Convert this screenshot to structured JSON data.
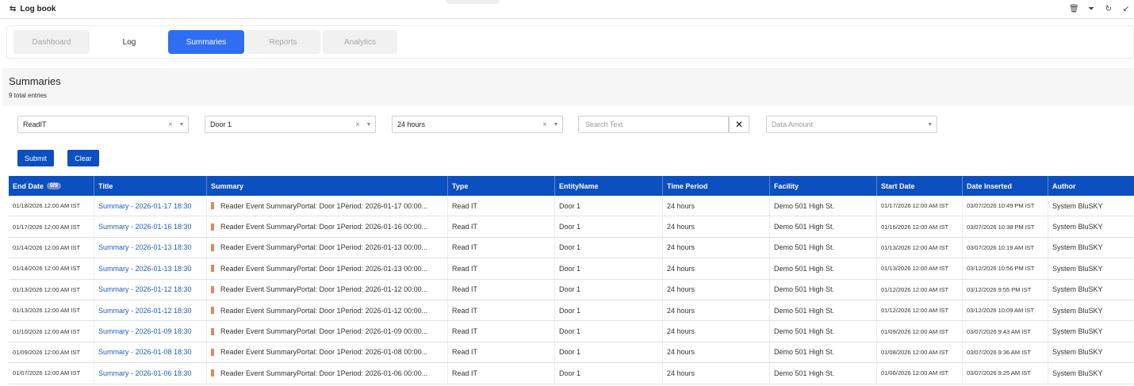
{
  "window": {
    "title": "Log book",
    "title_icon": "logbook-icon",
    "actions": [
      "trash-icon",
      "filter-icon",
      "refresh-icon",
      "collapse-icon"
    ]
  },
  "tabs": [
    {
      "label": "Dashboard",
      "state": "disabled"
    },
    {
      "label": "Log",
      "state": "normal"
    },
    {
      "label": "Summaries",
      "state": "active"
    },
    {
      "label": "Reports",
      "state": "disabled"
    },
    {
      "label": "Analytics",
      "state": "disabled"
    }
  ],
  "page": {
    "title": "Summaries",
    "subtitle": "9 total entries"
  },
  "filters": {
    "type": {
      "value": "ReadIT"
    },
    "entity": {
      "value": "Door 1"
    },
    "period": {
      "value": "24 hours"
    },
    "search": {
      "placeholder": "Search Text"
    },
    "data_amount": {
      "placeholder": "Data Amount"
    }
  },
  "buttons": {
    "submit": "Submit",
    "clear": "Clear"
  },
  "table": {
    "columns": [
      "End Date",
      "Title",
      "Summary",
      "Type",
      "EntityName",
      "Time Period",
      "Facility",
      "Start Date",
      "Date Inserted",
      "Author"
    ],
    "end_date_badge": "0/9",
    "rows": [
      [
        "01/18/2026 12:00 AM IST",
        "Summary - 2026-01-17 18:30",
        "Reader Event SummaryPortal: Door 1Period: 2026-01-17 00:00...",
        "Read IT",
        "Door 1",
        "24 hours",
        "Demo 501 High St.",
        "01/17/2026 12:00 AM IST",
        "03/07/2026 10:49 PM IST",
        "System BluSKY"
      ],
      [
        "01/17/2026 12:00 AM IST",
        "Summary - 2026-01-16 18:30",
        "Reader Event SummaryPortal: Door 1Period: 2026-01-16 00:00...",
        "Read IT",
        "Door 1",
        "24 hours",
        "Demo 501 High St.",
        "01/16/2026 12:00 AM IST",
        "03/07/2026 10:38 PM IST",
        "System BluSKY"
      ],
      [
        "01/14/2026 12:00 AM IST",
        "Summary - 2026-01-13 18:30",
        "Reader Event SummaryPortal: Door 1Period: 2026-01-13 00:00...",
        "Read IT",
        "Door 1",
        "24 hours",
        "Demo 501 High St.",
        "01/13/2026 12:00 AM IST",
        "03/07/2026 10:19 AM IST",
        "System BluSKY"
      ],
      [
        "01/14/2026 12:00 AM IST",
        "Summary - 2026-01-13 18:30",
        "Reader Event SummaryPortal: Door 1Period: 2026-01-13 00:00...",
        "Read IT",
        "Door 1",
        "24 hours",
        "Demo 501 High St.",
        "01/13/2026 12:00 AM IST",
        "03/12/2026 10:56 PM IST",
        "System BluSKY"
      ],
      [
        "01/13/2026 12:00 AM IST",
        "Summary - 2026-01-12 18:30",
        "Reader Event SummaryPortal: Door 1Period: 2026-01-12 00:00...",
        "Read IT",
        "Door 1",
        "24 hours",
        "Demo 501 High St.",
        "01/12/2026 12:00 AM IST",
        "03/12/2026 9:55 PM IST",
        "System BluSKY"
      ],
      [
        "01/13/2026 12:00 AM IST",
        "Summary - 2026-01-12 18:30",
        "Reader Event SummaryPortal: Door 1Period: 2026-01-12 00:00...",
        "Read IT",
        "Door 1",
        "24 hours",
        "Demo 501 High St.",
        "01/12/2026 12:00 AM IST",
        "03/12/2026 10:09 AM IST",
        "System BluSKY"
      ],
      [
        "01/10/2026 12:00 AM IST",
        "Summary - 2026-01-09 18:30",
        "Reader Event SummaryPortal: Door 1Period: 2026-01-09 00:00...",
        "Read IT",
        "Door 1",
        "24 hours",
        "Demo 501 High St.",
        "01/09/2026 12:00 AM IST",
        "03/07/2026 9:43 AM IST",
        "System BluSKY"
      ],
      [
        "01/09/2026 12:00 AM IST",
        "Summary - 2026-01-08 18:30",
        "Reader Event SummaryPortal: Door 1Period: 2026-01-08 00:00...",
        "Read IT",
        "Door 1",
        "24 hours",
        "Demo 501 High St.",
        "01/08/2026 12:00 AM IST",
        "03/07/2026 9:36 AM IST",
        "System BluSKY"
      ],
      [
        "01/07/2026 12:00 AM IST",
        "Summary - 2026-01-06 18:30",
        "Reader Event SummaryPortal: Door 1Period: 2026-01-06 00:00...",
        "Read IT",
        "Door 1",
        "24 hours",
        "Demo 501 High St.",
        "01/06/2026 12:00 AM IST",
        "03/07/2026 9:25 AM IST",
        "System BluSKY"
      ]
    ]
  },
  "colors": {
    "primary": "#0b4fc0",
    "active_tab": "#2f6ef0",
    "link": "#1f5fb8",
    "summary_marker": "#d98b5f"
  }
}
